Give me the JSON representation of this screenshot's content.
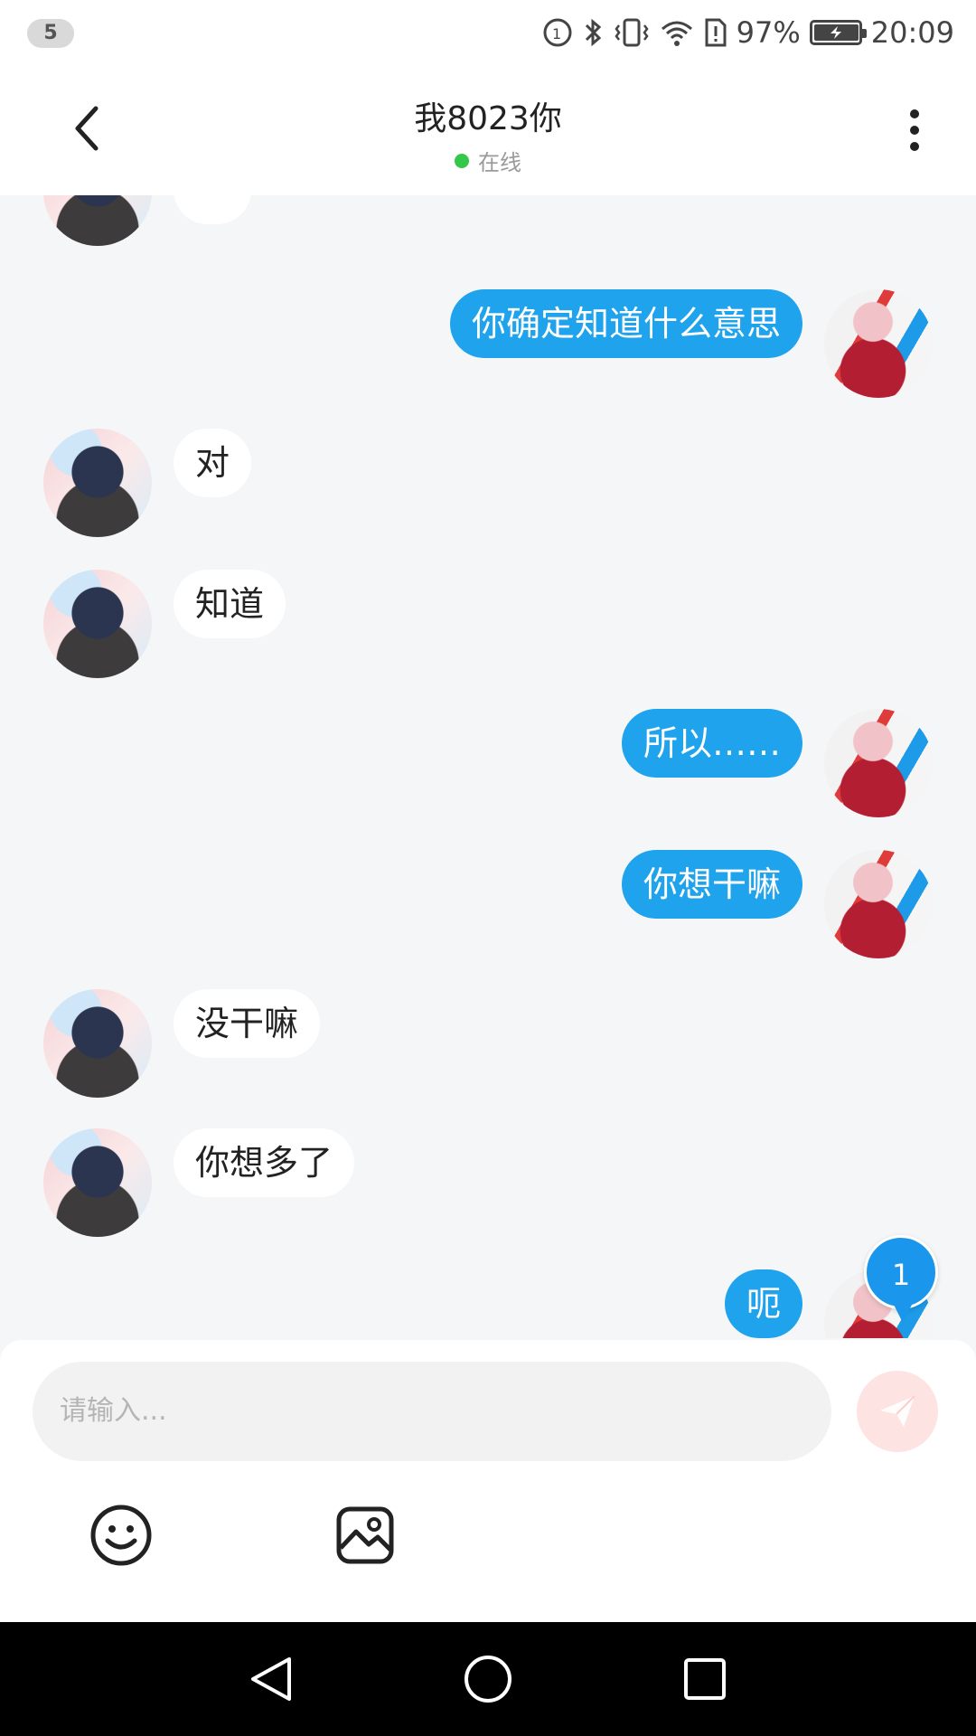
{
  "status_bar": {
    "notification_count": "5",
    "battery_percent": "97%",
    "battery_level": 0.97,
    "time": "20:09",
    "icons": [
      "data-saver-icon",
      "bluetooth-icon",
      "vibrate-icon",
      "wifi-icon",
      "sim-alert-icon",
      "battery-charging-icon"
    ]
  },
  "header": {
    "title": "我8023你",
    "status": "在线",
    "status_color": "#34c84a"
  },
  "messages": [
    {
      "sender": "me",
      "text": "你确定知道什么意思"
    },
    {
      "sender": "them",
      "text": "对"
    },
    {
      "sender": "them",
      "text": "知道"
    },
    {
      "sender": "me",
      "text": "所以……"
    },
    {
      "sender": "me",
      "text": "你想干嘛"
    },
    {
      "sender": "them",
      "text": "没干嘛"
    },
    {
      "sender": "them",
      "text": "你想多了"
    },
    {
      "sender": "me",
      "text": "呃"
    }
  ],
  "unread_badge": "1",
  "composer": {
    "placeholder": "请输入...",
    "tools": [
      "emoji-icon",
      "image-icon"
    ]
  },
  "colors": {
    "my_bubble": "#1fa3ec",
    "their_bubble": "#ffffff",
    "chat_background": "#f4f6f8",
    "send_button": "#fde3e1"
  }
}
